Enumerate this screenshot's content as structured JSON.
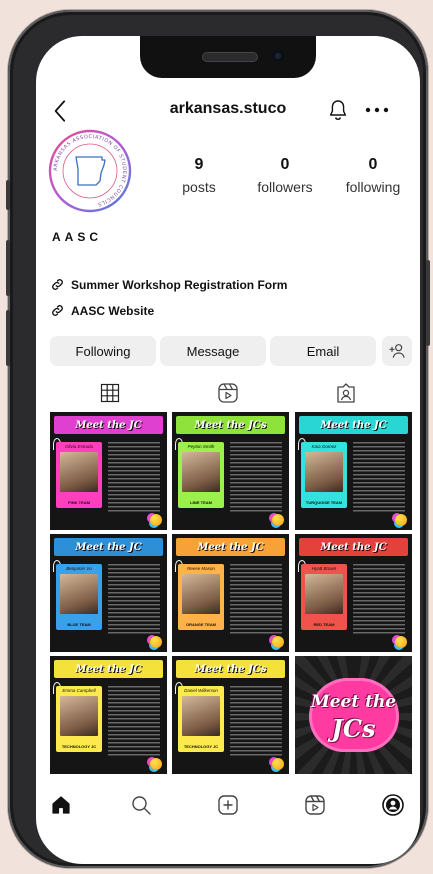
{
  "profile": {
    "username": "arkansas.stuco",
    "display_name": "AASC",
    "stats": [
      {
        "value": "9",
        "label": "posts"
      },
      {
        "value": "0",
        "label": "followers"
      },
      {
        "value": "0",
        "label": "following"
      }
    ],
    "links": [
      {
        "label": "Summer Workshop Registration Form",
        "icon": "link-icon"
      },
      {
        "label": "AASC Website",
        "icon": "link-icon"
      }
    ],
    "avatar_ring_text": "ARKANSAS ASSOCIATION OF STUDENT COUNCILS"
  },
  "actions": {
    "following": "Following",
    "message": "Message",
    "email": "Email",
    "add_person_icon": "add-person-icon"
  },
  "tabs": [
    "grid-icon",
    "reels-icon",
    "tagged-icon"
  ],
  "posts": [
    {
      "title": "Meet the JC",
      "title_color": "#e040d0",
      "card_color": "#ff3fbd",
      "name": "Olivia Estrada",
      "team": "PINK TEAM"
    },
    {
      "title": "Meet the JCs",
      "title_color": "#8ee23a",
      "card_color": "#9bf04b",
      "name": "Peyton Smith",
      "team": "LIME TEAM"
    },
    {
      "title": "Meet the JC",
      "title_color": "#29d6d4",
      "card_color": "#33e1de",
      "name": "Kaia Gomez",
      "team": "TURQUOISE TEAM"
    },
    {
      "title": "Meet the JC",
      "title_color": "#2f8fd6",
      "card_color": "#39a0ea",
      "name": "Benjamin Vu",
      "team": "BLUE TEAM"
    },
    {
      "title": "Meet the JC",
      "title_color": "#f6a238",
      "card_color": "#ffb24a",
      "name": "Reese Mason",
      "team": "ORANGE TEAM"
    },
    {
      "title": "Meet the JC",
      "title_color": "#e3413c",
      "card_color": "#f0524c",
      "name": "Hyatt Brown",
      "team": "RED TEAM"
    },
    {
      "title": "Meet the JC",
      "title_color": "#f4e13a",
      "card_color": "#fbe94d",
      "name": "Emma Campbell",
      "team": "TECHNOLOGY JC"
    },
    {
      "title": "Meet the JCs",
      "title_color": "#f4e13a",
      "card_color": "#fbe94d",
      "name": "Daniel Wilkerson",
      "team": "TECHNOLOGY JC"
    }
  ],
  "featured_post": {
    "line1": "Meet the",
    "line2": "JCs",
    "color": "#ff3aa0"
  },
  "bottom_nav": [
    "home-icon",
    "search-icon",
    "create-icon",
    "reels-nav-icon",
    "profile-nav-icon"
  ]
}
